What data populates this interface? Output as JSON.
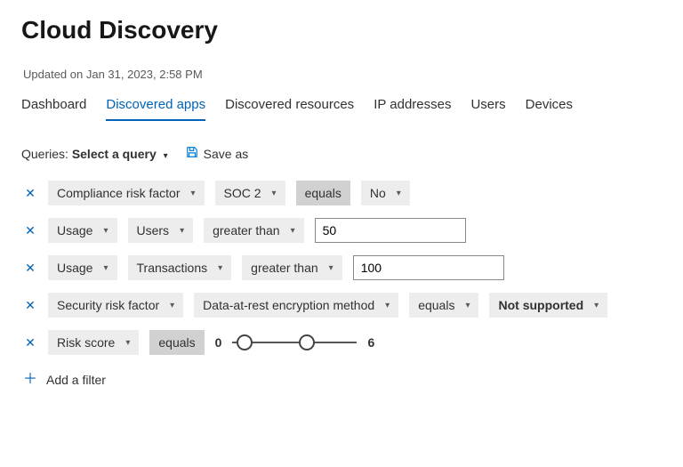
{
  "title": "Cloud Discovery",
  "updated": "Updated on Jan 31, 2023, 2:58 PM",
  "tabs": [
    {
      "label": "Dashboard",
      "active": false
    },
    {
      "label": "Discovered apps",
      "active": true
    },
    {
      "label": "Discovered resources",
      "active": false
    },
    {
      "label": "IP addresses",
      "active": false
    },
    {
      "label": "Users",
      "active": false
    },
    {
      "label": "Devices",
      "active": false
    }
  ],
  "queries": {
    "label": "Queries:",
    "selected": "Select a query",
    "save_as_label": "Save as"
  },
  "filters": [
    {
      "type": "categorical",
      "category": "Compliance risk factor",
      "sub": "SOC 2",
      "operator": "equals",
      "value": "No"
    },
    {
      "type": "numeric",
      "category": "Usage",
      "sub": "Users",
      "operator": "greater than",
      "value": "50"
    },
    {
      "type": "numeric",
      "category": "Usage",
      "sub": "Transactions",
      "operator": "greater than",
      "value": "100"
    },
    {
      "type": "categorical",
      "category": "Security risk factor",
      "sub": "Data-at-rest encryption method",
      "operator": "equals",
      "value": "Not supported"
    },
    {
      "type": "range",
      "category": "Risk score",
      "operator": "equals",
      "range_min_shown": "0",
      "range_max_shown": "6",
      "slider_low_pct": 10,
      "slider_high_pct": 60
    }
  ],
  "add_filter_label": "Add a filter"
}
